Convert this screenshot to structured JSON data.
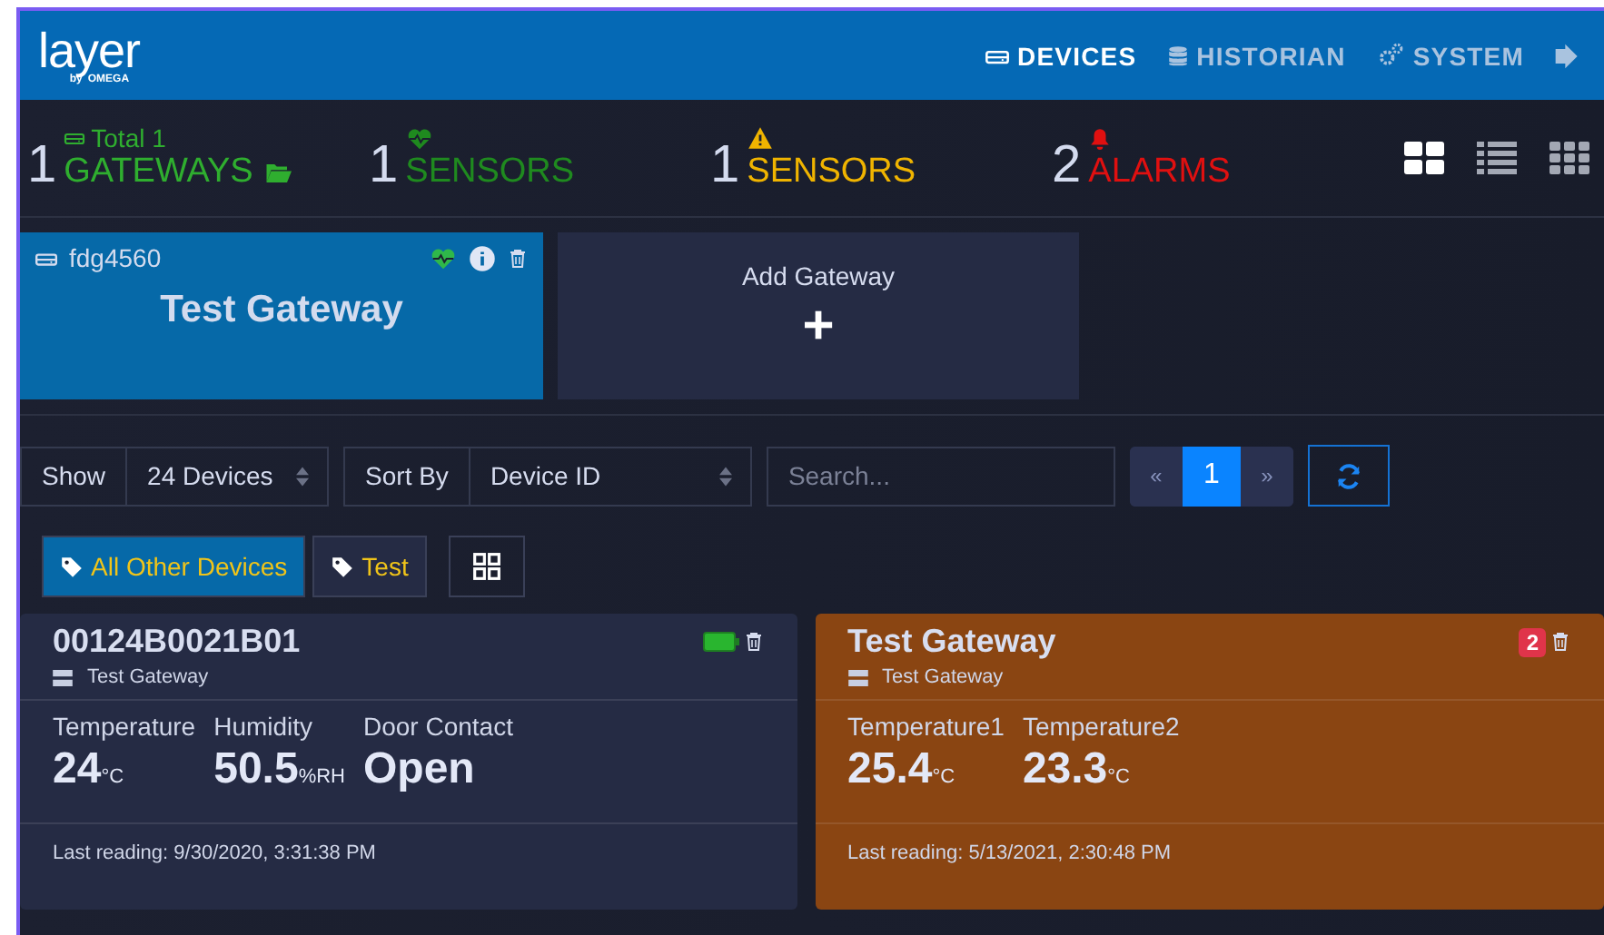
{
  "header": {
    "logo": {
      "text": "layer",
      "byline": "by",
      "brand": "OMEGA"
    },
    "nav": [
      {
        "label": "DEVICES",
        "kind": "devices",
        "selected": true
      },
      {
        "label": "HISTORIAN",
        "kind": "historian",
        "selected": false
      },
      {
        "label": "SYSTEM",
        "kind": "system",
        "selected": false
      }
    ]
  },
  "summary": {
    "items": [
      {
        "kind": "gateways",
        "count": "1",
        "total": "Total 1",
        "label": "GATEWAYS",
        "color": "#2fae2f"
      },
      {
        "kind": "healthy",
        "count": "1",
        "label": "SENSORS",
        "color": "#1f8a1f"
      },
      {
        "kind": "warning",
        "count": "1",
        "label": "SENSORS",
        "color": "#f0b400"
      },
      {
        "kind": "alarm",
        "count": "2",
        "label": "ALARMS",
        "color": "#e01010"
      }
    ],
    "views": [
      {
        "kind": "cards",
        "selected": true
      },
      {
        "kind": "list",
        "selected": false
      },
      {
        "kind": "tiles",
        "selected": false
      }
    ]
  },
  "gateways": [
    {
      "id": "fdg4560",
      "name": "Test Gateway",
      "selected": true
    }
  ],
  "add_gateway": {
    "label": "Add Gateway",
    "plus": "+"
  },
  "toolbar": {
    "show_label": "Show",
    "show_value": "24 Devices",
    "sort_label": "Sort By",
    "sort_value": "Device ID",
    "search": {
      "placeholder": "Search..."
    },
    "pagination": {
      "prev": "«",
      "pages": [
        {
          "label": "1",
          "selected": true
        }
      ],
      "next": "»"
    }
  },
  "tags": [
    {
      "label": "All Other Devices",
      "selected": true
    },
    {
      "label": "Test",
      "selected": false
    }
  ],
  "devices": [
    {
      "title": "00124B0021B01",
      "gateway": "Test Gateway",
      "kind": "battery",
      "alarm": false,
      "readings": [
        {
          "name": "Temperature",
          "value": "24",
          "unit": "°C"
        },
        {
          "name": "Humidity",
          "value": "50.5",
          "unit": "%RH"
        },
        {
          "name": "Door Contact",
          "value": "Open"
        }
      ],
      "last_reading": "Last reading: 9/30/2020, 3:31:38 PM"
    },
    {
      "title": "Test Gateway",
      "gateway": "Test Gateway",
      "kind": "alarms",
      "alarm_count": "2",
      "alarm": true,
      "readings": [
        {
          "name": "Temperature1",
          "value": "25.4",
          "unit": "°C"
        },
        {
          "name": "Temperature2",
          "value": "23.3",
          "unit": "°C"
        }
      ],
      "last_reading": "Last reading: 5/13/2021, 2:30:48 PM"
    }
  ]
}
